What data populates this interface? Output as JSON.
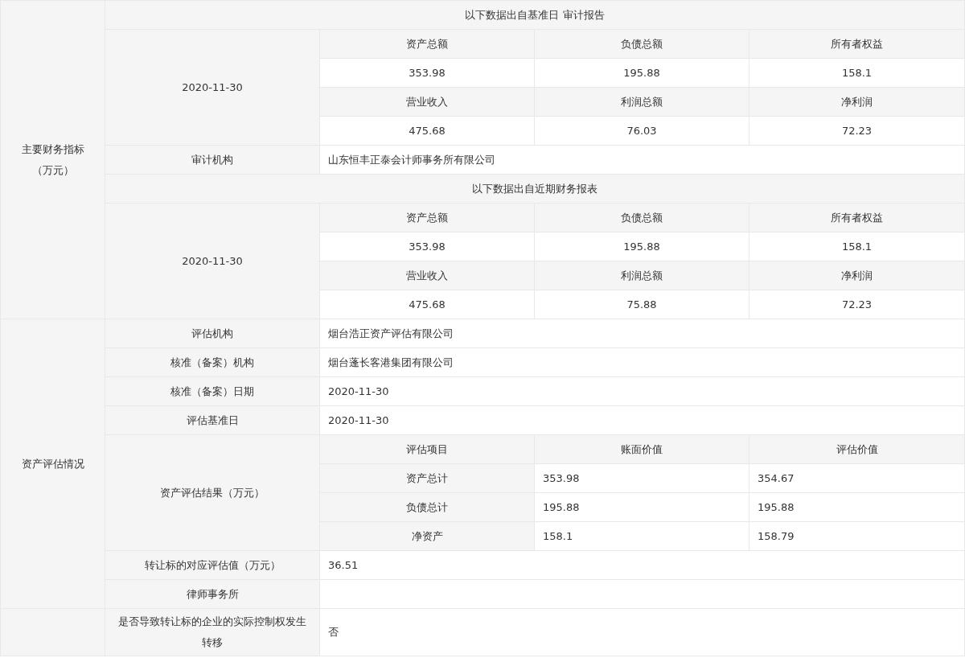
{
  "sections": [
    {
      "label": "主要财务指标（万元）",
      "rows": [
        {
          "kind": "heading",
          "text": "以下数据出自基准日 审计报告"
        },
        {
          "kind": "metrics",
          "date": "2020-11-30",
          "groups": [
            {
              "labels": [
                "资产总额",
                "负债总额",
                "所有者权益"
              ],
              "values": [
                "353.98",
                "195.88",
                "158.1"
              ]
            },
            {
              "labels": [
                "营业收入",
                "利润总额",
                "净利润"
              ],
              "values": [
                "475.68",
                "76.03",
                "72.23"
              ]
            }
          ]
        },
        {
          "kind": "field",
          "label": "审计机构",
          "value": "山东恒丰正泰会计师事务所有限公司"
        },
        {
          "kind": "heading",
          "text": "以下数据出自近期财务报表"
        },
        {
          "kind": "metrics",
          "date": "2020-11-30",
          "groups": [
            {
              "labels": [
                "资产总额",
                "负债总额",
                "所有者权益"
              ],
              "values": [
                "353.98",
                "195.88",
                "158.1"
              ]
            },
            {
              "labels": [
                "营业收入",
                "利润总额",
                "净利润"
              ],
              "values": [
                "475.68",
                "75.88",
                "72.23"
              ]
            }
          ]
        }
      ]
    },
    {
      "label": "资产评估情况",
      "rows": [
        {
          "kind": "field",
          "label": "评估机构",
          "value": "烟台浩正资产评估有限公司"
        },
        {
          "kind": "field",
          "label": "核准（备案）机构",
          "value": "烟台蓬长客港集团有限公司"
        },
        {
          "kind": "field",
          "label": "核准（备案）日期",
          "value": "2020-11-30"
        },
        {
          "kind": "field",
          "label": "评估基准日",
          "value": "2020-11-30"
        },
        {
          "kind": "results",
          "label": "资产评估结果（万元）",
          "columns": [
            "评估项目",
            "账面价值",
            "评估价值"
          ],
          "rows": [
            [
              "资产总计",
              "353.98",
              "354.67"
            ],
            [
              "负债总计",
              "195.88",
              "195.88"
            ],
            [
              "净资产",
              "158.1",
              "158.79"
            ]
          ]
        },
        {
          "kind": "field",
          "label": "转让标的对应评估值（万元）",
          "value": "36.51"
        },
        {
          "kind": "field",
          "label": "律师事务所"
        }
      ]
    },
    {
      "rows": [
        {
          "kind": "field",
          "label": "是否导致转让标的企业的实际控制权发生转移",
          "value": "否"
        }
      ]
    }
  ]
}
